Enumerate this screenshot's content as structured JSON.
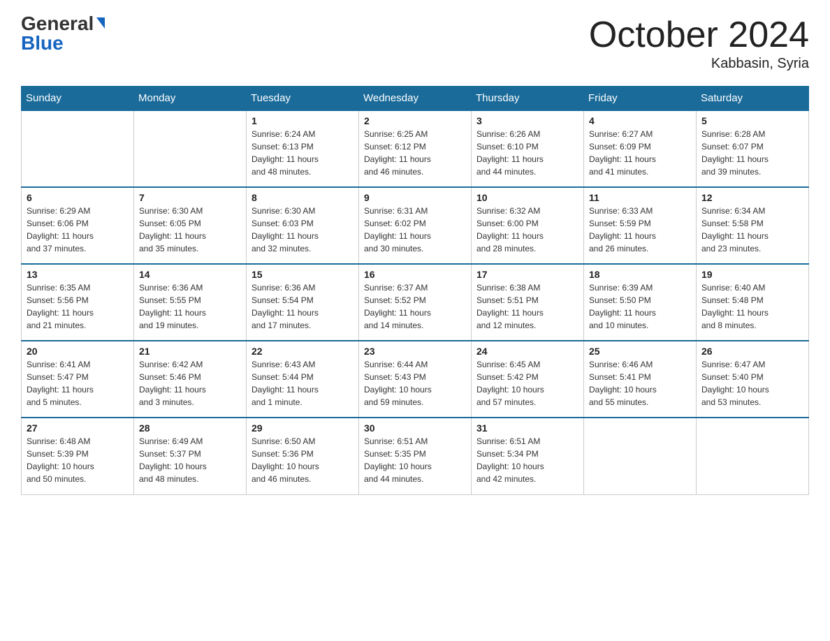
{
  "logo": {
    "general": "General",
    "blue": "Blue"
  },
  "title": "October 2024",
  "subtitle": "Kabbasin, Syria",
  "headers": [
    "Sunday",
    "Monday",
    "Tuesday",
    "Wednesday",
    "Thursday",
    "Friday",
    "Saturday"
  ],
  "weeks": [
    [
      {
        "day": "",
        "info": ""
      },
      {
        "day": "",
        "info": ""
      },
      {
        "day": "1",
        "info": "Sunrise: 6:24 AM\nSunset: 6:13 PM\nDaylight: 11 hours\nand 48 minutes."
      },
      {
        "day": "2",
        "info": "Sunrise: 6:25 AM\nSunset: 6:12 PM\nDaylight: 11 hours\nand 46 minutes."
      },
      {
        "day": "3",
        "info": "Sunrise: 6:26 AM\nSunset: 6:10 PM\nDaylight: 11 hours\nand 44 minutes."
      },
      {
        "day": "4",
        "info": "Sunrise: 6:27 AM\nSunset: 6:09 PM\nDaylight: 11 hours\nand 41 minutes."
      },
      {
        "day": "5",
        "info": "Sunrise: 6:28 AM\nSunset: 6:07 PM\nDaylight: 11 hours\nand 39 minutes."
      }
    ],
    [
      {
        "day": "6",
        "info": "Sunrise: 6:29 AM\nSunset: 6:06 PM\nDaylight: 11 hours\nand 37 minutes."
      },
      {
        "day": "7",
        "info": "Sunrise: 6:30 AM\nSunset: 6:05 PM\nDaylight: 11 hours\nand 35 minutes."
      },
      {
        "day": "8",
        "info": "Sunrise: 6:30 AM\nSunset: 6:03 PM\nDaylight: 11 hours\nand 32 minutes."
      },
      {
        "day": "9",
        "info": "Sunrise: 6:31 AM\nSunset: 6:02 PM\nDaylight: 11 hours\nand 30 minutes."
      },
      {
        "day": "10",
        "info": "Sunrise: 6:32 AM\nSunset: 6:00 PM\nDaylight: 11 hours\nand 28 minutes."
      },
      {
        "day": "11",
        "info": "Sunrise: 6:33 AM\nSunset: 5:59 PM\nDaylight: 11 hours\nand 26 minutes."
      },
      {
        "day": "12",
        "info": "Sunrise: 6:34 AM\nSunset: 5:58 PM\nDaylight: 11 hours\nand 23 minutes."
      }
    ],
    [
      {
        "day": "13",
        "info": "Sunrise: 6:35 AM\nSunset: 5:56 PM\nDaylight: 11 hours\nand 21 minutes."
      },
      {
        "day": "14",
        "info": "Sunrise: 6:36 AM\nSunset: 5:55 PM\nDaylight: 11 hours\nand 19 minutes."
      },
      {
        "day": "15",
        "info": "Sunrise: 6:36 AM\nSunset: 5:54 PM\nDaylight: 11 hours\nand 17 minutes."
      },
      {
        "day": "16",
        "info": "Sunrise: 6:37 AM\nSunset: 5:52 PM\nDaylight: 11 hours\nand 14 minutes."
      },
      {
        "day": "17",
        "info": "Sunrise: 6:38 AM\nSunset: 5:51 PM\nDaylight: 11 hours\nand 12 minutes."
      },
      {
        "day": "18",
        "info": "Sunrise: 6:39 AM\nSunset: 5:50 PM\nDaylight: 11 hours\nand 10 minutes."
      },
      {
        "day": "19",
        "info": "Sunrise: 6:40 AM\nSunset: 5:48 PM\nDaylight: 11 hours\nand 8 minutes."
      }
    ],
    [
      {
        "day": "20",
        "info": "Sunrise: 6:41 AM\nSunset: 5:47 PM\nDaylight: 11 hours\nand 5 minutes."
      },
      {
        "day": "21",
        "info": "Sunrise: 6:42 AM\nSunset: 5:46 PM\nDaylight: 11 hours\nand 3 minutes."
      },
      {
        "day": "22",
        "info": "Sunrise: 6:43 AM\nSunset: 5:44 PM\nDaylight: 11 hours\nand 1 minute."
      },
      {
        "day": "23",
        "info": "Sunrise: 6:44 AM\nSunset: 5:43 PM\nDaylight: 10 hours\nand 59 minutes."
      },
      {
        "day": "24",
        "info": "Sunrise: 6:45 AM\nSunset: 5:42 PM\nDaylight: 10 hours\nand 57 minutes."
      },
      {
        "day": "25",
        "info": "Sunrise: 6:46 AM\nSunset: 5:41 PM\nDaylight: 10 hours\nand 55 minutes."
      },
      {
        "day": "26",
        "info": "Sunrise: 6:47 AM\nSunset: 5:40 PM\nDaylight: 10 hours\nand 53 minutes."
      }
    ],
    [
      {
        "day": "27",
        "info": "Sunrise: 6:48 AM\nSunset: 5:39 PM\nDaylight: 10 hours\nand 50 minutes."
      },
      {
        "day": "28",
        "info": "Sunrise: 6:49 AM\nSunset: 5:37 PM\nDaylight: 10 hours\nand 48 minutes."
      },
      {
        "day": "29",
        "info": "Sunrise: 6:50 AM\nSunset: 5:36 PM\nDaylight: 10 hours\nand 46 minutes."
      },
      {
        "day": "30",
        "info": "Sunrise: 6:51 AM\nSunset: 5:35 PM\nDaylight: 10 hours\nand 44 minutes."
      },
      {
        "day": "31",
        "info": "Sunrise: 6:51 AM\nSunset: 5:34 PM\nDaylight: 10 hours\nand 42 minutes."
      },
      {
        "day": "",
        "info": ""
      },
      {
        "day": "",
        "info": ""
      }
    ]
  ]
}
